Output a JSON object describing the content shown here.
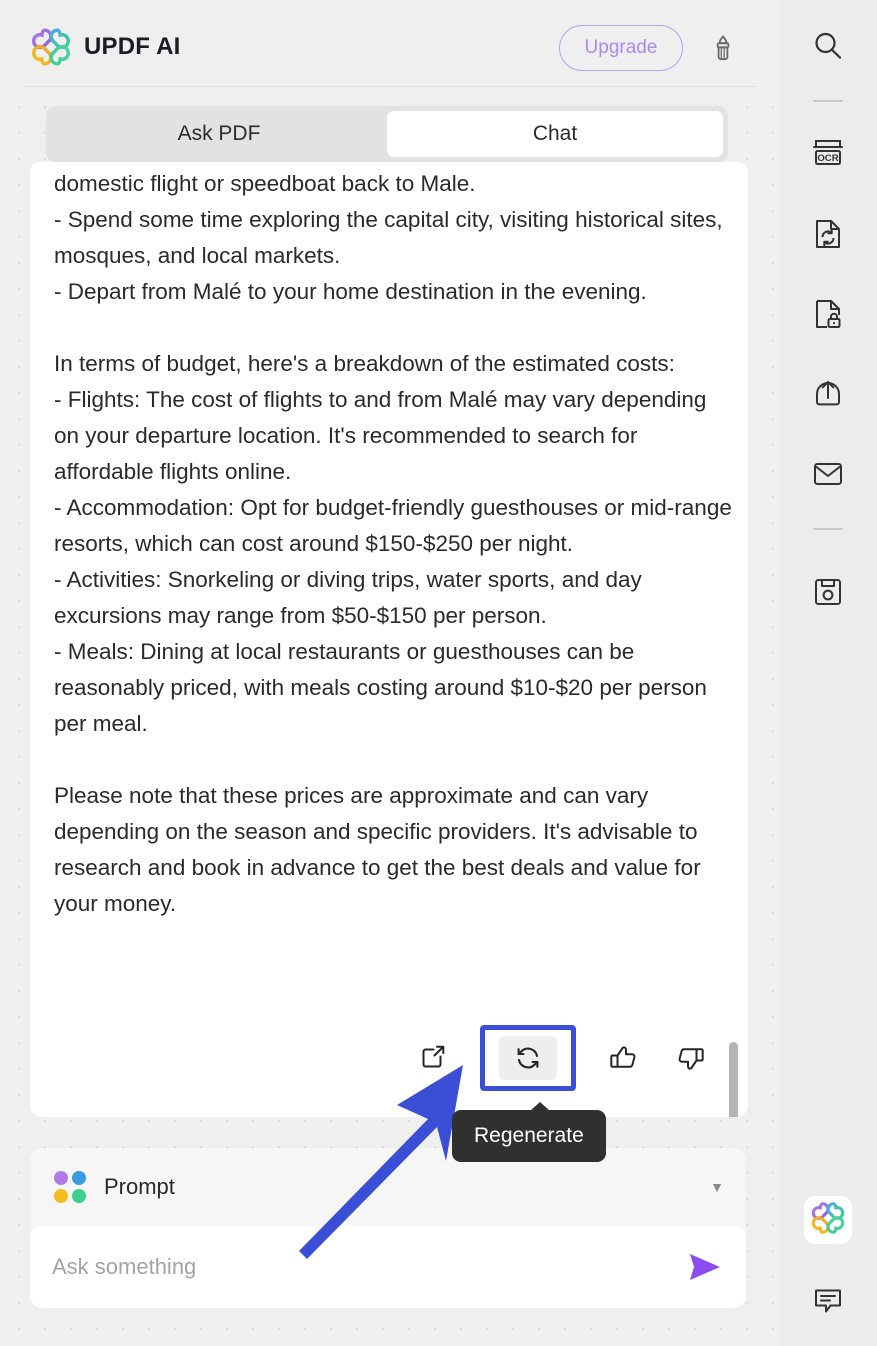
{
  "header": {
    "brand_title": "UPDF AI",
    "logo_icon": "updf-clover-logo",
    "upgrade_label": "Upgrade",
    "brush_icon": "brush-icon"
  },
  "tabs": [
    {
      "label": "Ask PDF",
      "active": false,
      "name": "tab-ask-pdf"
    },
    {
      "label": "Chat",
      "active": true,
      "name": "tab-chat"
    }
  ],
  "message": {
    "text": "domestic flight or speedboat back to Male.\n- Spend some time exploring the capital city, visiting historical sites, mosques, and local markets.\n- Depart from Malé to your home destination in the evening.\n\nIn terms of budget, here's a breakdown of the estimated costs:\n- Flights: The cost of flights to and from Malé may vary depending on your departure location. It's recommended to search for affordable flights online.\n- Accommodation: Opt for budget-friendly guesthouses or mid-range resorts, which can cost around $150-$250 per night.\n- Activities: Snorkeling or diving trips, water sports, and day excursions may range from $50-$150 per person.\n- Meals: Dining at local restaurants or guesthouses can be reasonably priced, with meals costing around $10-$20 per person per meal.\n\nPlease note that these prices are approximate and can vary depending on the season and specific providers. It's advisable to research and book in advance to get the best deals and value for your money."
  },
  "message_actions": [
    {
      "name": "share-button",
      "icon": "external-link-icon",
      "highlighted": false
    },
    {
      "name": "regenerate-button",
      "icon": "regenerate-icon",
      "highlighted": true
    },
    {
      "name": "thumbs-up-button",
      "icon": "thumbs-up-icon",
      "highlighted": false
    },
    {
      "name": "thumbs-down-button",
      "icon": "thumbs-down-icon",
      "highlighted": false
    }
  ],
  "tooltip": {
    "label": "Regenerate"
  },
  "composer": {
    "prompt_label": "Prompt",
    "prompt_icon": "four-dots-icon",
    "caret_icon": "chevron-down-icon",
    "input_placeholder": "Ask something",
    "input_value": "",
    "send_icon": "send-arrow-icon"
  },
  "toolbar": [
    {
      "name": "search-tool",
      "icon": "search-icon",
      "label": "Search"
    },
    {
      "name": "ocr-tool",
      "icon": "ocr-icon",
      "label": "OCR"
    },
    {
      "name": "convert-tool",
      "icon": "convert-document-icon",
      "label": "Convert"
    },
    {
      "name": "protect-tool",
      "icon": "protect-document-icon",
      "label": "Protect"
    },
    {
      "name": "share-tool",
      "icon": "share-upload-icon",
      "label": "Share"
    },
    {
      "name": "email-tool",
      "icon": "email-icon",
      "label": "Email"
    },
    {
      "name": "save-tool",
      "icon": "save-disk-icon",
      "label": "Save"
    },
    {
      "name": "updf-ai-tool",
      "icon": "updf-clover-logo",
      "label": "UPDF AI"
    },
    {
      "name": "comment-tool",
      "icon": "comment-bubble-icon",
      "label": "Comment"
    }
  ],
  "colors": {
    "accent_purple": "#8b4df0",
    "brand_light_purple": "#a98bf0",
    "annotation_blue": "#3b4fd6",
    "panel_bg": "#efefef",
    "card_bg": "#ffffff",
    "tooltip_bg": "#303030",
    "dot_purple": "#b07ce8",
    "dot_blue": "#3b9ae1",
    "dot_yellow": "#f5bd1f",
    "dot_green": "#3ecf8e"
  }
}
